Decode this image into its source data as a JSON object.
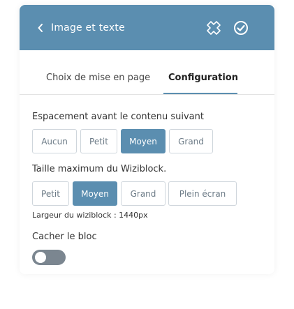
{
  "header": {
    "title": "Image et texte",
    "back_icon": "chevron-left-icon",
    "close_icon": "close-icon",
    "confirm_icon": "check-circle-icon",
    "background_color": "#5b8eb0"
  },
  "tabs": [
    {
      "label": "Choix de mise en page",
      "active": false
    },
    {
      "label": "Configuration",
      "active": true
    }
  ],
  "spacing": {
    "label": "Espacement avant le contenu suivant",
    "options": [
      "Aucun",
      "Petit",
      "Moyen",
      "Grand"
    ],
    "selected": "Moyen"
  },
  "max_size": {
    "label": "Taille maximum du Wiziblock.",
    "options": [
      "Petit",
      "Moyen",
      "Grand",
      "Plein écran"
    ],
    "selected": "Moyen",
    "note": "Largeur du wiziblock : 1440px"
  },
  "hide_block": {
    "label": "Cacher le bloc",
    "enabled": false
  },
  "accent_color": "#5b8eb0"
}
